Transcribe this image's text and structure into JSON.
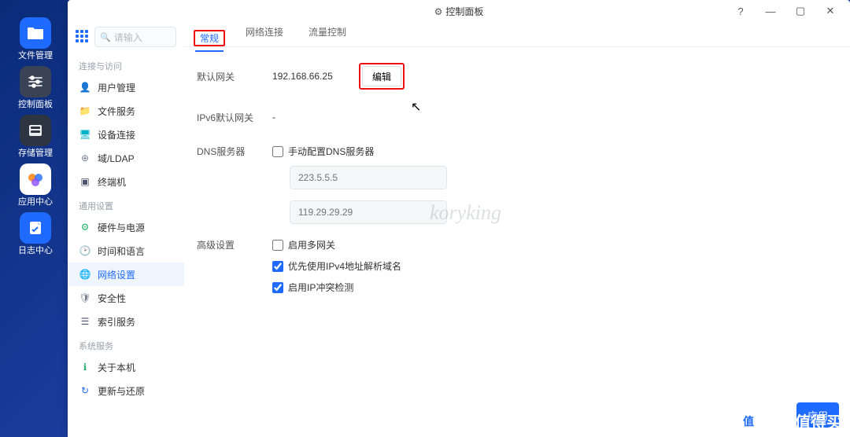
{
  "dock": {
    "items": [
      {
        "label": "文件管理"
      },
      {
        "label": "控制面板"
      },
      {
        "label": "存储管理"
      },
      {
        "label": "应用中心"
      },
      {
        "label": "日志中心"
      }
    ]
  },
  "window": {
    "title": "控制面板",
    "help": "?",
    "minimize": "—",
    "maximize": "▢",
    "close": "✕"
  },
  "sidebar": {
    "search_placeholder": "请输入",
    "sections": {
      "s0": "连接与访问",
      "s1": "通用设置",
      "s2": "系统服务"
    },
    "items": {
      "user": "用户管理",
      "file": "文件服务",
      "device": "设备连接",
      "ldap": "域/LDAP",
      "terminal": "终端机",
      "hw": "硬件与电源",
      "time": "时间和语言",
      "net": "网络设置",
      "sec": "安全性",
      "index": "索引服务",
      "about": "关于本机",
      "update": "更新与还原"
    }
  },
  "tabs": {
    "general": "常规",
    "conn": "网络连接",
    "flow": "流量控制"
  },
  "form": {
    "gateway_label": "默认网关",
    "gateway_value": "192.168.66.25",
    "edit_btn": "编辑",
    "ipv6_label": "IPv6默认网关",
    "ipv6_value": "-",
    "dns_label": "DNS服务器",
    "dns_manual": "手动配置DNS服务器",
    "dns1": "223.5.5.5",
    "dns2": "119.29.29.29",
    "adv_label": "高级设置",
    "adv_multi": "启用多网关",
    "adv_ipv4": "优先使用IPv4地址解析域名",
    "adv_conflict": "启用IP冲突检测"
  },
  "publish_btn": "应用",
  "watermark": "koryking",
  "brand": "什么值得买",
  "brand_badge": "值"
}
